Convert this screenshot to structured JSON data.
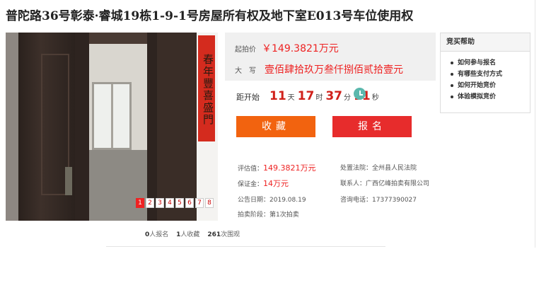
{
  "title": "普陀路36号彰泰·睿城19栋1-9-1号房屋所有权及地下室E013号车位使用权",
  "photo": {
    "couplet_text": "春年豐喜盛門",
    "pager": [
      "1",
      "2",
      "3",
      "4",
      "5",
      "6",
      "7",
      "8"
    ],
    "active_page": "1"
  },
  "stats": {
    "signup_count": "0",
    "signup_label": "人报名",
    "favorite_count": "1",
    "favorite_label": "人收藏",
    "view_count": "261",
    "view_label": "次围观"
  },
  "price": {
    "start_label": "起拍价",
    "start_value": "￥149.3821万元",
    "caps_label": "大　写",
    "caps_value": "壹佰肆拾玖万叁仟捌佰贰拾壹元"
  },
  "countdown": {
    "label": "距开始",
    "days": "11",
    "days_unit": "天",
    "hours": "17",
    "hours_unit": "时",
    "minutes": "37",
    "minutes_unit": "分",
    "seconds": "11",
    "seconds_unit": "秒"
  },
  "buttons": {
    "favorite": "收藏",
    "register": "报名"
  },
  "info": {
    "appraisal_label": "评估值：",
    "appraisal_value": "149.3821万元",
    "deposit_label": "保证金：",
    "deposit_value": "14万元",
    "announce_label": "公告日期：",
    "announce_value": "2019.08.19",
    "stage_label": "拍卖阶段：",
    "stage_value": "第1次拍卖",
    "court_label": "处置法院：",
    "court_value": "全州县人民法院",
    "contact_label": "联系人：",
    "contact_value": "广西亿峰拍卖有限公司",
    "phone_label": "咨询电话：",
    "phone_value": "17377390027"
  },
  "help": {
    "title": "竞买帮助",
    "items": [
      "如何参与报名",
      "有哪些支付方式",
      "如何开始竞价",
      "体验模拟竞价"
    ]
  },
  "colors": {
    "accent_red": "#e22222",
    "orange": "#f2630f",
    "clock": "#5bb8ad"
  }
}
